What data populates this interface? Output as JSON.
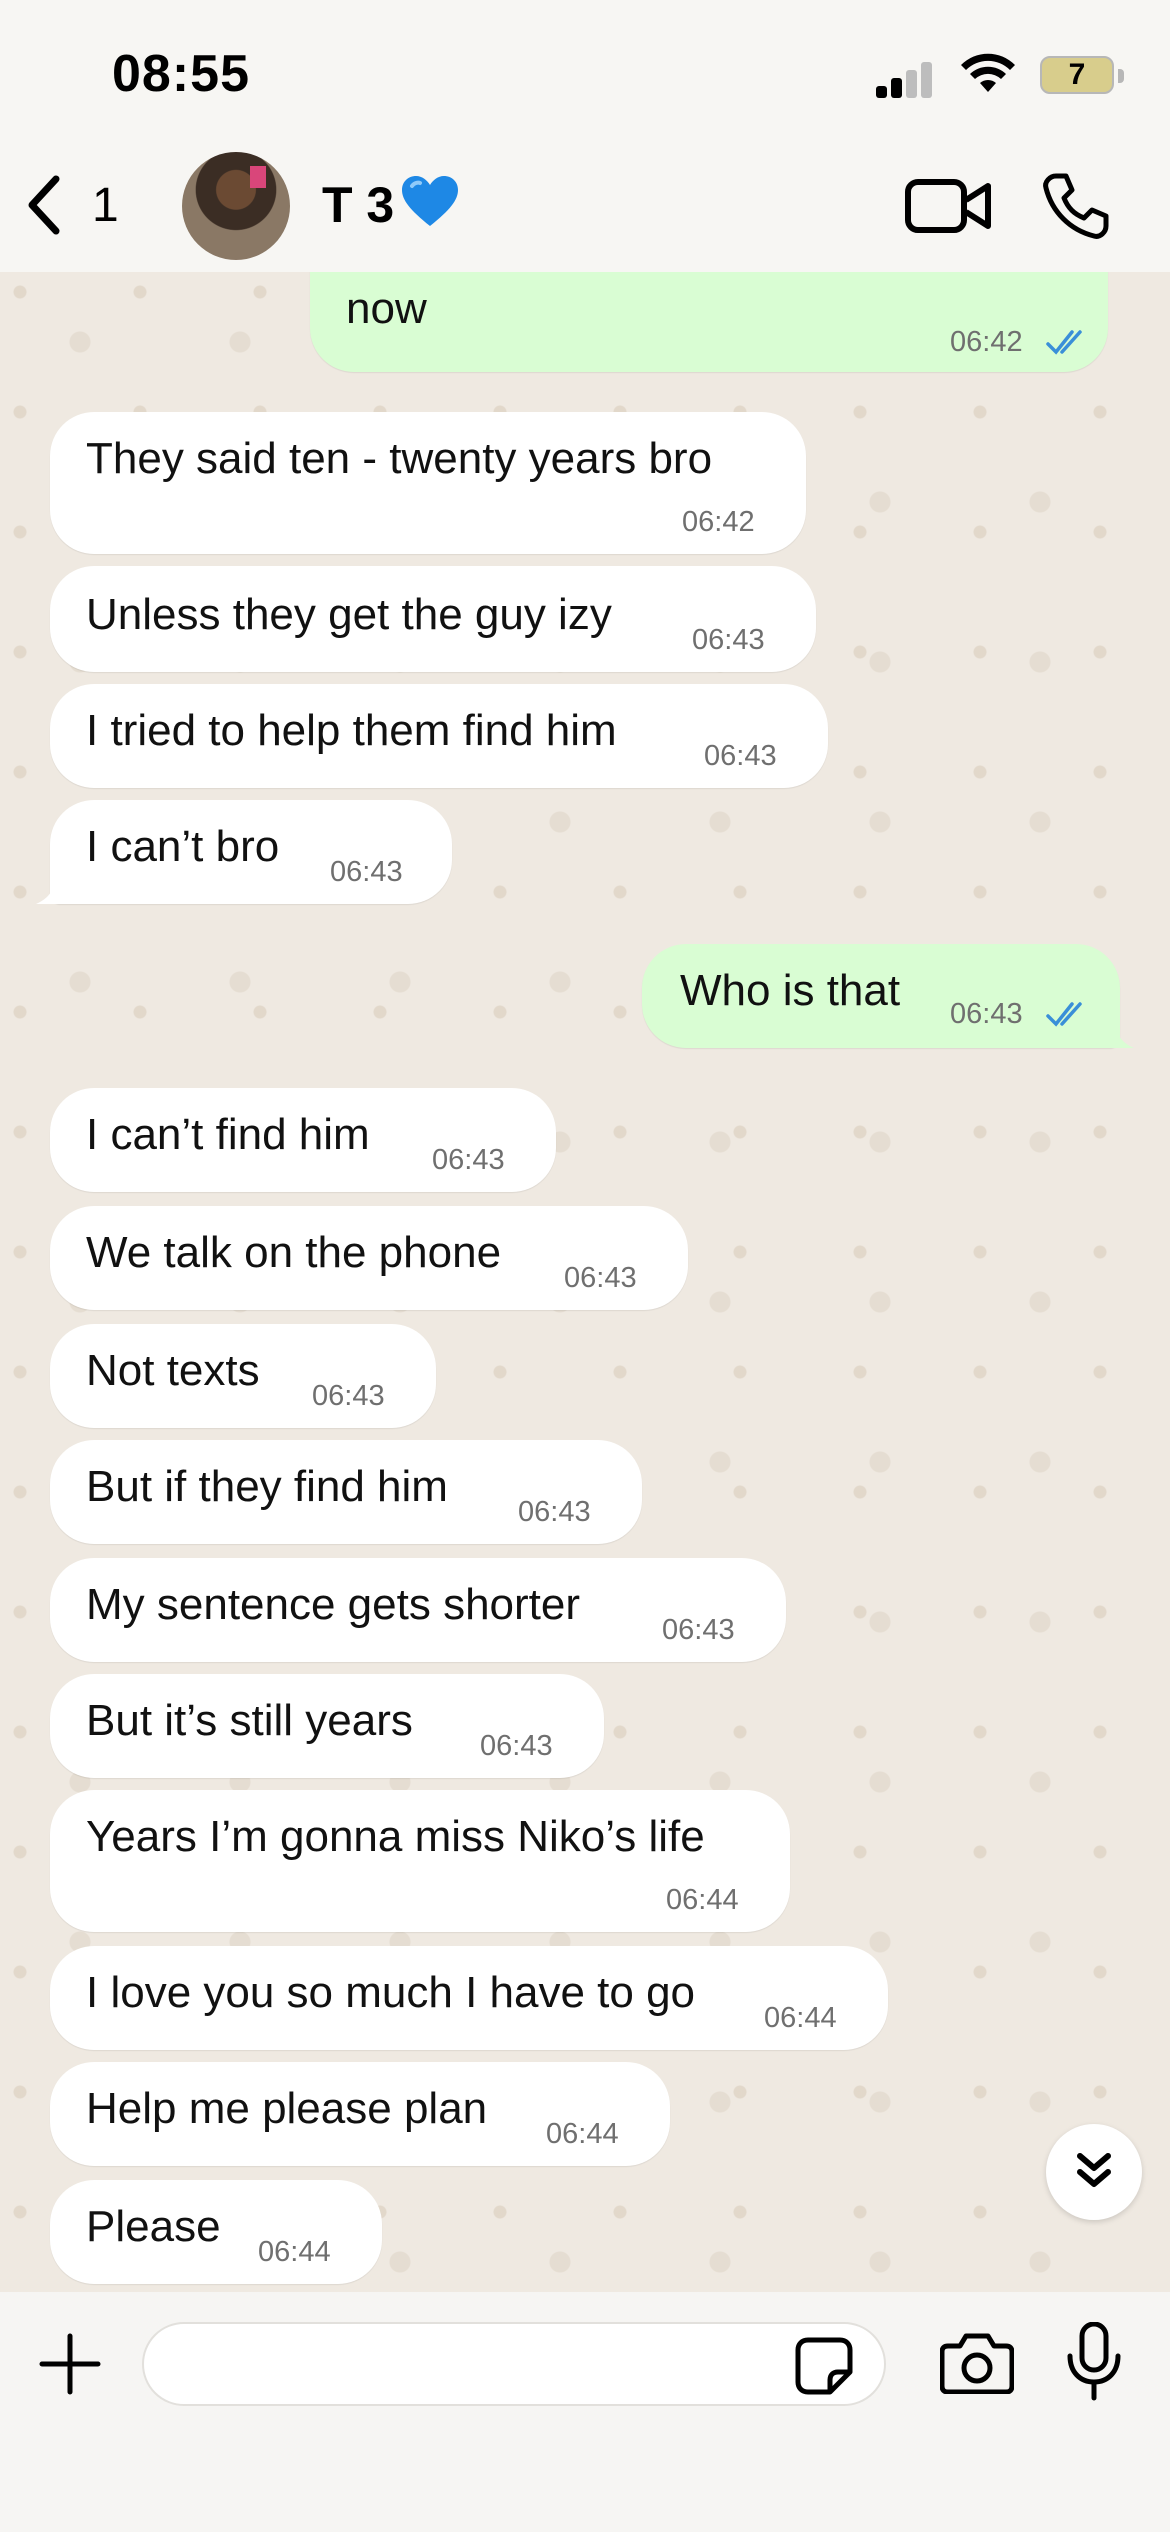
{
  "status_bar": {
    "time": "08:55",
    "battery": "7"
  },
  "header": {
    "back_count": "1",
    "contact_name": "T 3",
    "contact_emoji_icon": "blue-heart-icon"
  },
  "messages": [
    {
      "dir": "out",
      "text": "now",
      "time": "06:42",
      "read": true
    },
    {
      "dir": "in",
      "text": "They said ten - twenty years bro",
      "time": "06:42"
    },
    {
      "dir": "in",
      "text": "Unless they get the guy izy",
      "time": "06:43"
    },
    {
      "dir": "in",
      "text": "I tried to help them find him",
      "time": "06:43"
    },
    {
      "dir": "in",
      "text": "I can’t bro",
      "time": "06:43"
    },
    {
      "dir": "out",
      "text": "Who is that",
      "time": "06:43",
      "read": true
    },
    {
      "dir": "in",
      "text": "I can’t find him",
      "time": "06:43"
    },
    {
      "dir": "in",
      "text": "We talk on the phone",
      "time": "06:43"
    },
    {
      "dir": "in",
      "text": "Not texts",
      "time": "06:43"
    },
    {
      "dir": "in",
      "text": "But if they find him",
      "time": "06:43"
    },
    {
      "dir": "in",
      "text": "My sentence gets shorter",
      "time": "06:43"
    },
    {
      "dir": "in",
      "text": "But it’s still years",
      "time": "06:43"
    },
    {
      "dir": "in",
      "text": "Years I’m gonna miss Niko’s life",
      "time": "06:44"
    },
    {
      "dir": "in",
      "text": "I love you so much I have to go",
      "time": "06:44"
    },
    {
      "dir": "in",
      "text": "Help me please plan",
      "time": "06:44"
    },
    {
      "dir": "in",
      "text": "Please",
      "time": "06:44"
    }
  ],
  "composer": {
    "value": "",
    "placeholder": ""
  },
  "colors": {
    "outgoing_bubble": "#d9fdd3",
    "incoming_bubble": "#ffffff",
    "read_tick": "#3a8fd8",
    "wallpaper": "#efe9e1"
  }
}
